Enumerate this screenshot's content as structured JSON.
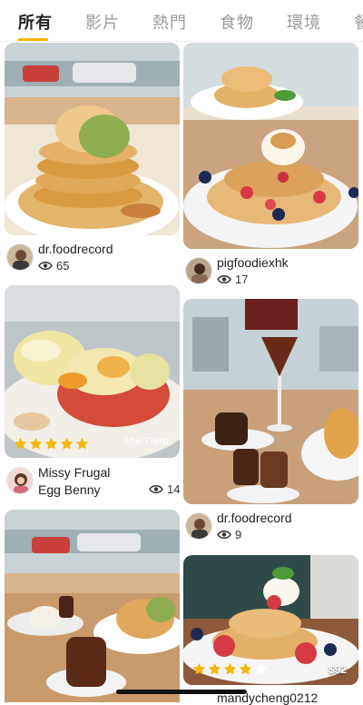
{
  "tabs": [
    {
      "label": "所有",
      "active": true
    },
    {
      "label": "影片",
      "active": false
    },
    {
      "label": "熱門",
      "active": false
    },
    {
      "label": "食物",
      "active": false
    },
    {
      "label": "環境",
      "active": false
    },
    {
      "label": "餐",
      "active": false
    }
  ],
  "feed": {
    "posts": [
      {
        "user": "dr.foodrecord",
        "views": "65"
      },
      {
        "user": "pigfoodiexhk",
        "views": "17"
      },
      {
        "user": "Missy Frugal",
        "subtitle": "Egg  Benny",
        "views": "14",
        "rating": 5,
        "watermark": "The Third"
      },
      {
        "user": "dr.foodrecord",
        "views": "9"
      },
      {
        "user": "",
        "views": ""
      },
      {
        "user": "mandycheng0212",
        "views": "",
        "rating": 4,
        "price": "$92"
      }
    ]
  },
  "colors": {
    "accent": "#f4b400",
    "star": "#f5b70a",
    "star_empty": "#ffffff"
  }
}
